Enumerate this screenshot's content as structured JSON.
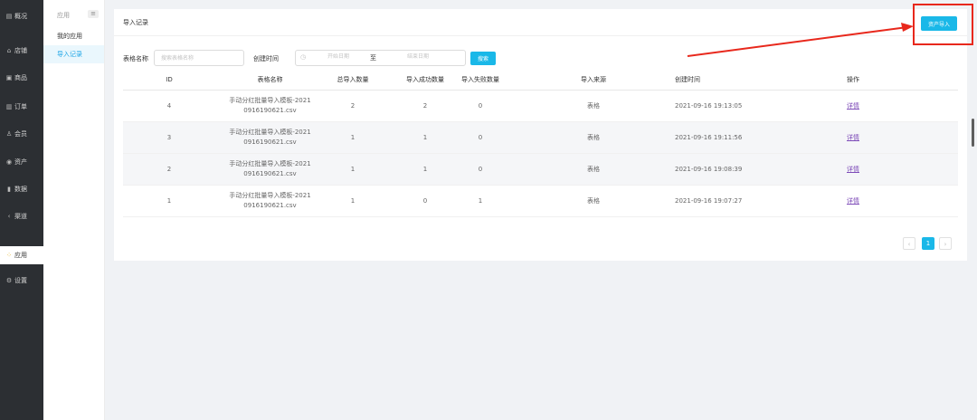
{
  "sidebar": {
    "items": [
      {
        "icon": "overview-icon",
        "glyph": "▤",
        "label": "概况"
      },
      {
        "icon": "store-icon",
        "glyph": "⌂",
        "label": "店铺"
      },
      {
        "icon": "goods-icon",
        "glyph": "▣",
        "label": "商品"
      },
      {
        "icon": "order-icon",
        "glyph": "▥",
        "label": "订单"
      },
      {
        "icon": "member-icon",
        "glyph": "♙",
        "label": "会员"
      },
      {
        "icon": "asset-icon",
        "glyph": "◉",
        "label": "资产"
      },
      {
        "icon": "data-icon",
        "glyph": "▮",
        "label": "数据"
      },
      {
        "icon": "channel-icon",
        "glyph": "‹",
        "label": "渠道"
      },
      {
        "icon": "apps-icon",
        "glyph": "⁘",
        "label": "应用"
      },
      {
        "icon": "settings-icon",
        "glyph": "⚙",
        "label": "设置"
      }
    ],
    "active_index": 8
  },
  "subnav": {
    "title": "应用",
    "toggle_glyph": "≡",
    "items": [
      {
        "label": "我的应用"
      },
      {
        "label": "导入记录"
      }
    ],
    "active_index": 1
  },
  "main": {
    "title": "导入记录",
    "import_button": "资产导入",
    "filters": {
      "name_label": "表格名称",
      "name_placeholder": "搜索表格名称",
      "time_label": "创建时间",
      "start_placeholder": "开始日期",
      "separator": "至",
      "end_placeholder": "结束日期",
      "search_button": "搜索"
    },
    "table": {
      "columns": [
        "ID",
        "表格名称",
        "总导入数量",
        "导入成功数量",
        "导入失败数量",
        "导入来源",
        "创建时间",
        "操作"
      ],
      "rows": [
        {
          "id": "4",
          "name_line1": "手动分红批量导入模板-2021",
          "name_line2": "0916190621.csv",
          "total": "2",
          "success": "2",
          "fail": "0",
          "source": "表格",
          "created": "2021-09-16 19:13:05",
          "action": "详情"
        },
        {
          "id": "3",
          "name_line1": "手动分红批量导入模板-2021",
          "name_line2": "0916190621.csv",
          "total": "1",
          "success": "1",
          "fail": "0",
          "source": "表格",
          "created": "2021-09-16 19:11:56",
          "action": "详情"
        },
        {
          "id": "2",
          "name_line1": "手动分红批量导入模板-2021",
          "name_line2": "0916190621.csv",
          "total": "1",
          "success": "1",
          "fail": "0",
          "source": "表格",
          "created": "2021-09-16 19:08:39",
          "action": "详情"
        },
        {
          "id": "1",
          "name_line1": "手动分红批量导入模板-2021",
          "name_line2": "0916190621.csv",
          "total": "1",
          "success": "0",
          "fail": "1",
          "source": "表格",
          "created": "2021-09-16 19:07:27",
          "action": "详情"
        }
      ]
    },
    "pagination": {
      "prev": "‹",
      "current": "1",
      "next": "›"
    }
  },
  "colors": {
    "accent": "#1ab8e8",
    "sidebar_bg": "#2c2f33",
    "annotation_red": "#e8281c",
    "link": "#7d4bb8"
  }
}
